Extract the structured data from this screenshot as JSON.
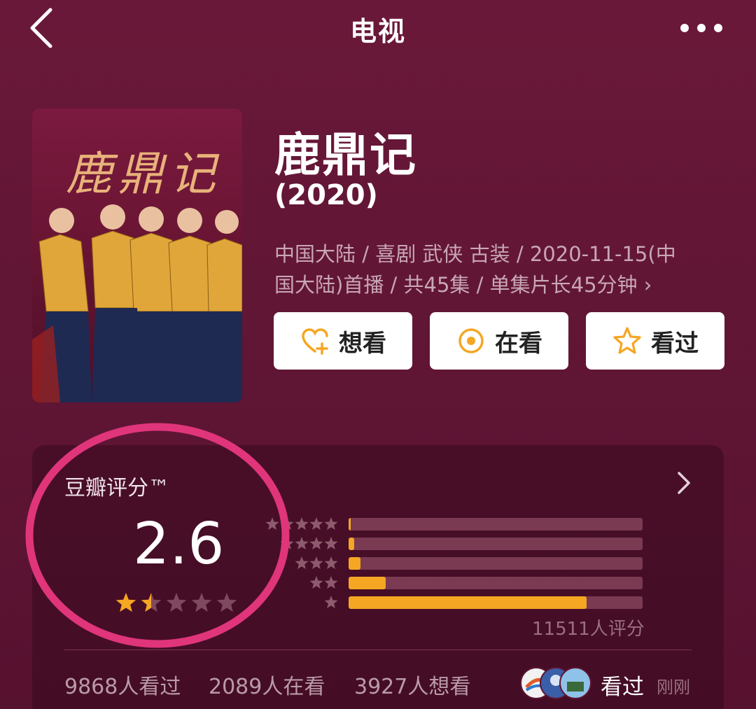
{
  "header": {
    "title": "电视"
  },
  "show": {
    "poster_title": "鹿鼎记",
    "title": "鹿鼎记",
    "year": "(2020)",
    "meta_line1": "中国大陆 / 喜剧 武侠 古装 / 2020-11-15(中",
    "meta_line2": "国大陆)首播 / 共45集 / 单集片长45分钟 ›"
  },
  "actions": {
    "want_label": "想看",
    "watching_label": "在看",
    "watched_label": "看过"
  },
  "rating": {
    "label": "豆瓣评分™",
    "score": "2.6",
    "score_stars": 1.5,
    "distribution": [
      {
        "stars": 5,
        "fraction": 0.005
      },
      {
        "stars": 4,
        "fraction": 0.02
      },
      {
        "stars": 3,
        "fraction": 0.04
      },
      {
        "stars": 2,
        "fraction": 0.125
      },
      {
        "stars": 1,
        "fraction": 0.81
      }
    ],
    "count_text": "11511人评分"
  },
  "stats": {
    "watched": "9868人看过",
    "watching": "2089人在看",
    "want": "3927人想看"
  },
  "friend_activity": {
    "action": "看过",
    "time": "刚刚"
  },
  "colors": {
    "background": "#5e1533",
    "accent": "#f5a623",
    "bar_track": "#7a3a52",
    "highlight": "#e0357a"
  }
}
